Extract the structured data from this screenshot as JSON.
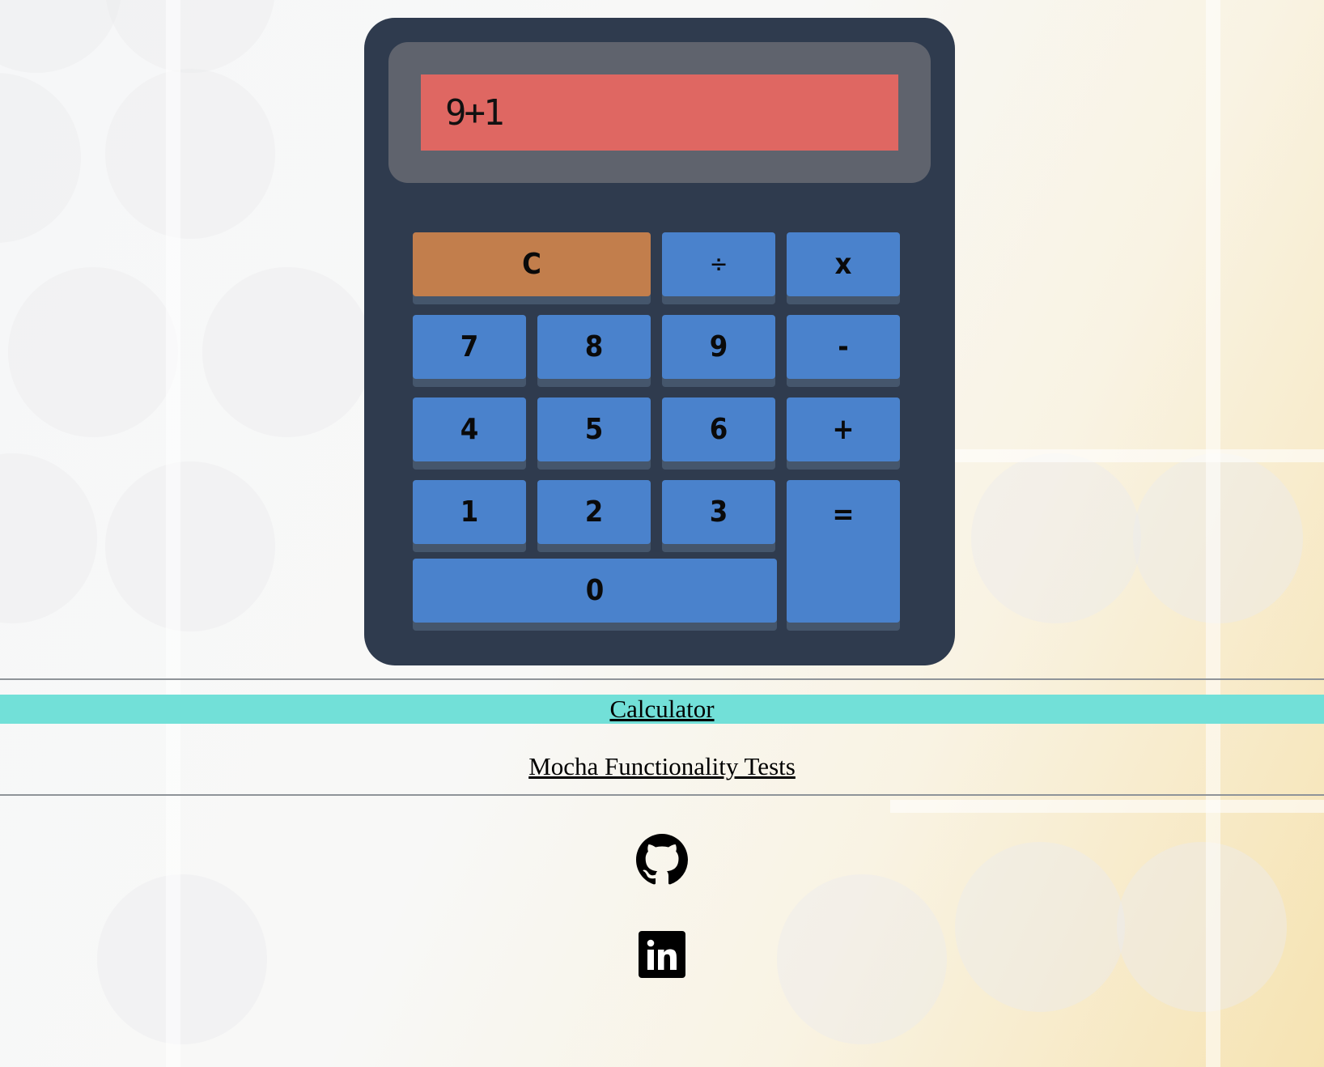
{
  "calculator": {
    "display_value": "9+1",
    "keys": {
      "clear": "C",
      "divide": "÷",
      "multiply": "x",
      "seven": "7",
      "eight": "8",
      "nine": "9",
      "minus": "-",
      "four": "4",
      "five": "5",
      "six": "6",
      "plus": "+",
      "one": "1",
      "two": "2",
      "three": "3",
      "equals": "=",
      "zero": "0"
    }
  },
  "links": {
    "calculator": "Calculator",
    "tests": "Mocha Functionality Tests"
  },
  "social": {
    "github_icon": "github-icon",
    "linkedin_icon": "linkedin-icon"
  },
  "colors": {
    "calculator_body": "#2f3b4e",
    "display_frame": "#5f636d",
    "display": "#df6762",
    "key": "#4a82cc",
    "clear_key": "#c27e4c",
    "nav_bar": "#72e0d8"
  }
}
